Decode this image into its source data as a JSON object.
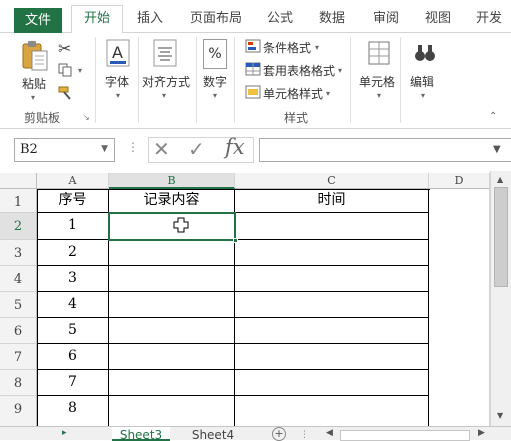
{
  "ribbon_tabs": [
    "文件",
    "开始",
    "插入",
    "页面布局",
    "公式",
    "数据",
    "审阅",
    "视图",
    "开发"
  ],
  "active_tab": "开始",
  "clipboard": {
    "paste_label": "粘贴",
    "group_label": "剪贴板"
  },
  "font": {
    "label": "字体"
  },
  "alignment": {
    "label": "对齐方式"
  },
  "number": {
    "label": "数字",
    "percent_symbol": "%"
  },
  "styles": {
    "conditional_label": "条件格式",
    "table_format_label": "套用表格格式",
    "cell_styles_label": "单元格样式",
    "group_label": "样式"
  },
  "cells_group": {
    "label": "单元格"
  },
  "editing_group": {
    "label": "编辑"
  },
  "formula_bar": {
    "name_box": "B2",
    "fx": "fx",
    "formula_value": ""
  },
  "columns": [
    "A",
    "B",
    "C",
    "D"
  ],
  "selected_column": "B",
  "rows": [
    "1",
    "2",
    "3",
    "4",
    "5",
    "6",
    "7",
    "8",
    "9"
  ],
  "selected_row": "2",
  "table": {
    "headers": [
      "序号",
      "记录内容",
      "时间"
    ],
    "serials": [
      "1",
      "2",
      "3",
      "4",
      "5",
      "6",
      "7",
      "8"
    ]
  },
  "sheet_tabs": [
    "Sheet3",
    "Sheet4"
  ],
  "active_sheet": "Sheet3",
  "colors": {
    "accent": "#217346",
    "file_tab_bg": "#217346"
  }
}
